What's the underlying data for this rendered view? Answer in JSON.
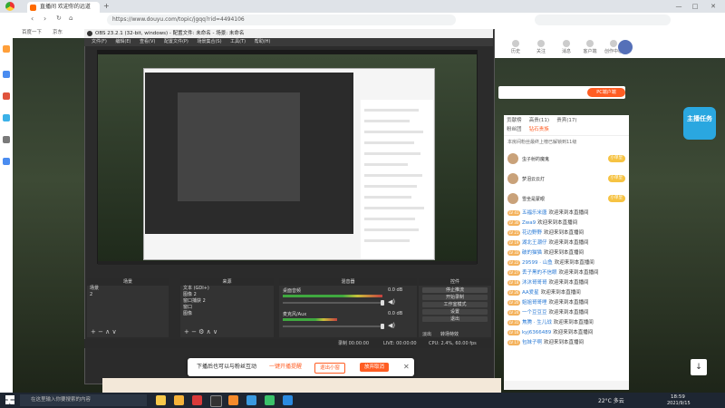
{
  "browser": {
    "tab_title": "直播间 欢迎你的远道",
    "url": "https://www.douyu.com/topic/jgqq?rid=4494106",
    "bookmarks": [
      "百度一下",
      "京东"
    ],
    "window_controls": [
      "—",
      "□",
      "✕"
    ]
  },
  "douyu": {
    "header_items": [
      "历史",
      "关注",
      "消息",
      "客户端",
      "创作中心"
    ],
    "follow_button": "PC端户端",
    "gift_float": "主播任务",
    "chat": {
      "tabs": [
        "贡献榜",
        "高贵(11)",
        "贵宾(17)",
        "粉丝团",
        "钻石贵族"
      ],
      "notice": "本房间粉丝最终上榜已解锁到11级",
      "rank_list": [
        {
          "name": "虫子射的魔鬼",
          "badge": "小单皇"
        },
        {
          "name": "梦泪云云灯",
          "badge": "小单皇"
        },
        {
          "name": "雪坐是蒙眼",
          "badge": "小单皇"
        }
      ],
      "messages": [
        {
          "level": "LV 41",
          "nick": "五福乐米唐",
          "text": "欢迎来到本直播间"
        },
        {
          "level": "LV 30",
          "nick": "Zwa9",
          "text": "欢迎来到本直播间"
        },
        {
          "level": "LV 21",
          "nick": "花边野野",
          "text": "欢迎来到本直播间"
        },
        {
          "level": "LV 19",
          "nick": "湖北王潮仔",
          "text": "欢迎来到本直播间"
        },
        {
          "level": "LV 33",
          "nick": "破的猫猫",
          "text": "欢迎来到本直播间"
        },
        {
          "level": "LV 22",
          "nick": "29599 · 山鱼",
          "text": "欢迎来到本直播间"
        },
        {
          "level": "LV 27",
          "nick": "丢子黑的不信眼",
          "text": "欢迎来到本直播间"
        },
        {
          "level": "LV 18",
          "nick": "沐沐哥哥哥",
          "text": "欢迎来到本直播间"
        },
        {
          "level": "LV 26",
          "nick": "AA爱星",
          "text": "欢迎来到本直播间"
        },
        {
          "level": "LV 20",
          "nick": "姐姐哥哥哩",
          "text": "欢迎来到本直播间"
        },
        {
          "level": "LV 24",
          "nick": "一个豆豆豆",
          "text": "欢迎来到本直播间"
        },
        {
          "level": "LV 31",
          "nick": "焦腾 · 生儿战",
          "text": "欢迎来到本直播间"
        },
        {
          "level": "LV 16",
          "nick": "kyj6366489",
          "text": "欢迎来到本直播间"
        },
        {
          "level": "LV 17",
          "nick": "包妹子啊",
          "text": "欢迎来到本直播间"
        }
      ]
    }
  },
  "obs": {
    "title": "OBS 23.2.1 (32-bit, windows) - 配置文件: 未命名 - 场景: 未命名",
    "menu": [
      "文件(F)",
      "编辑(E)",
      "查看(V)",
      "配置文件(P)",
      "场景集合(S)",
      "工具(T)",
      "帮助(H)"
    ],
    "docks": {
      "scenes": {
        "header": "场景",
        "items": [
          "场景",
          "2"
        ]
      },
      "sources": {
        "header": "来源",
        "items": [
          "文本 (GDI+)",
          "图像 2",
          "窗口捕获 2",
          "窗口",
          "图像"
        ]
      },
      "mixer": {
        "header": "混音器",
        "tracks": [
          {
            "name": "桌面音频",
            "level": "0.0 dB"
          },
          {
            "name": "麦克风/Aux",
            "level": "0.0 dB"
          }
        ]
      },
      "controls": {
        "header": "控件",
        "buttons": [
          "停止推流",
          "开始录制",
          "工作室模式",
          "设置",
          "退出"
        ]
      },
      "transitions": [
        "淡出",
        "转场特效"
      ]
    },
    "status": {
      "rec": "录制 00:00:00",
      "live": "LIVE: 00:00:00",
      "cpu": "CPU: 2.4%, 60.00 fps"
    }
  },
  "popup": {
    "text": "下播后也可以与粉丝互动",
    "link": "一键开播提醒",
    "btn_secondary": "退出小窗",
    "btn_primary": "放弃取消"
  },
  "taskbar": {
    "search_placeholder": "在这里输入你要搜索的内容",
    "weather": "22°C 多云",
    "time": "18:59",
    "date": "2021/9/15"
  }
}
